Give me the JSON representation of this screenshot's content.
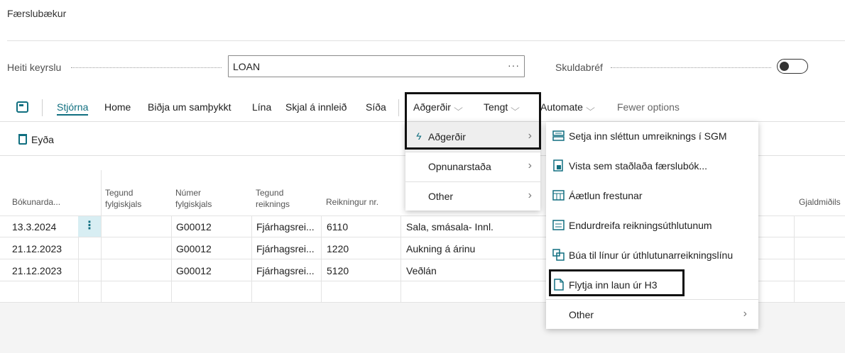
{
  "page": {
    "title": "Færslubækur"
  },
  "form": {
    "batch_label": "Heiti keyrslu",
    "batch_value": "LOAN",
    "batch_ellipsis": "···",
    "promissory_label": "Skuldabréf"
  },
  "action_bar": {
    "items": [
      "Stjórna",
      "Home",
      "Biðja um samþykkt",
      "Lína",
      "Skjal á innleið",
      "Síða",
      "Aðgerðir",
      "Tengt",
      "Automate",
      "Fewer options"
    ]
  },
  "toolbar": {
    "delete_label": "Eyða"
  },
  "grid": {
    "headers": {
      "posting_date": "Bókunarda...",
      "doc_type": [
        "Tegund",
        "fylgiskjals"
      ],
      "doc_no": [
        "Númer",
        "fylgiskjals"
      ],
      "acct_type": [
        "Tegund",
        "reiknings"
      ],
      "acct_no": "Reikningur nr.",
      "currency": "Gjaldmiðils"
    },
    "rows": [
      {
        "date": "13.3.2024",
        "doc_no": "G00012",
        "acct_type": "Fjárhagsrei...",
        "acct_no": "6110",
        "desc": "Sala, smásala- Innl."
      },
      {
        "date": "21.12.2023",
        "doc_no": "G00012",
        "acct_type": "Fjárhagsrei...",
        "acct_no": "1220",
        "desc": "Aukning á árinu"
      },
      {
        "date": "21.12.2023",
        "doc_no": "G00012",
        "acct_type": "Fjárhagsrei...",
        "acct_no": "5120",
        "desc": "Veðlán"
      }
    ],
    "row_menu_glyph": "⋮"
  },
  "menu_actions": {
    "items": [
      "Aðgerðir",
      "Opnunarstaða",
      "Other"
    ]
  },
  "submenu": {
    "items": [
      "Setja inn sléttun umreiknings í SGM",
      "Vista sem staðlaða færslubók...",
      "Áætlun frestunar",
      "Endurdreifa reikningsúthlutunum",
      "Búa til línur úr úthlutunarreikningslínu",
      "Flytja inn laun úr H3",
      "Other"
    ]
  },
  "colors": {
    "accent": "#106f80",
    "highlight_border": "#111111"
  }
}
